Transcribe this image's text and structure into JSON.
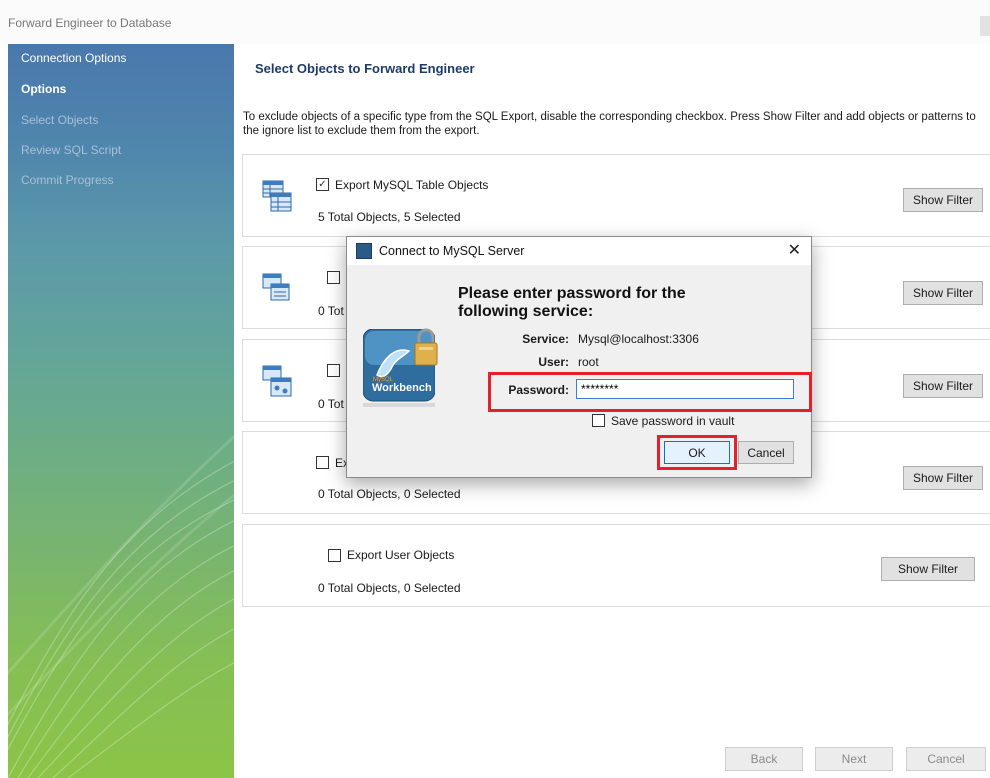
{
  "window": {
    "title": "Forward Engineer to Database"
  },
  "sidebar": {
    "steps": [
      {
        "label": "Connection Options",
        "state": "done"
      },
      {
        "label": "Options",
        "state": "active"
      },
      {
        "label": "Select Objects",
        "state": "pending"
      },
      {
        "label": "Review SQL Script",
        "state": "pending"
      },
      {
        "label": "Commit Progress",
        "state": "pending"
      }
    ]
  },
  "main": {
    "title": "Select Objects to Forward Engineer",
    "intro": "To exclude objects of a specific type from the SQL Export, disable the corresponding checkbox. Press Show Filter and add objects or patterns to the ignore list to exclude them from the export.",
    "groups": [
      {
        "checkbox_label": "Export MySQL Table Objects",
        "checked": true,
        "summary": "5 Total Objects, 5 Selected",
        "filter_button": "Show Filter",
        "icon": "table-objects-icon"
      },
      {
        "checkbox_label": "",
        "checked": false,
        "summary": "0 Tot",
        "filter_button": "Show Filter",
        "icon": "view-objects-icon"
      },
      {
        "checkbox_label": "",
        "checked": false,
        "summary": "0 Tot",
        "filter_button": "Show Filter",
        "icon": "routine-objects-icon"
      },
      {
        "checkbox_label": "Ex",
        "checked": false,
        "summary": "0 Total Objects, 0 Selected",
        "filter_button": "Show Filter",
        "icon": ""
      },
      {
        "checkbox_label": "Export User Objects",
        "checked": false,
        "summary": "0 Total Objects, 0 Selected",
        "filter_button": "Show Filter",
        "icon": ""
      }
    ]
  },
  "footer": {
    "back": "Back",
    "next": "Next",
    "cancel": "Cancel"
  },
  "dialog": {
    "title": "Connect to MySQL Server",
    "close": "✕",
    "heading": "Please enter password for the following service:",
    "service_label": "Service:",
    "service_value": "Mysql@localhost:3306",
    "user_label": "User:",
    "user_value": "root",
    "password_label": "Password:",
    "password_value": "********",
    "save_label": "Save password in vault",
    "save_checked": false,
    "ok": "OK",
    "cancel": "Cancel",
    "logo_text": "Workbench",
    "logo_small": "MySQL"
  },
  "colors": {
    "highlight": "#e3212b",
    "title_blue": "#1d3b6a",
    "focus": "#3c7fd2"
  }
}
